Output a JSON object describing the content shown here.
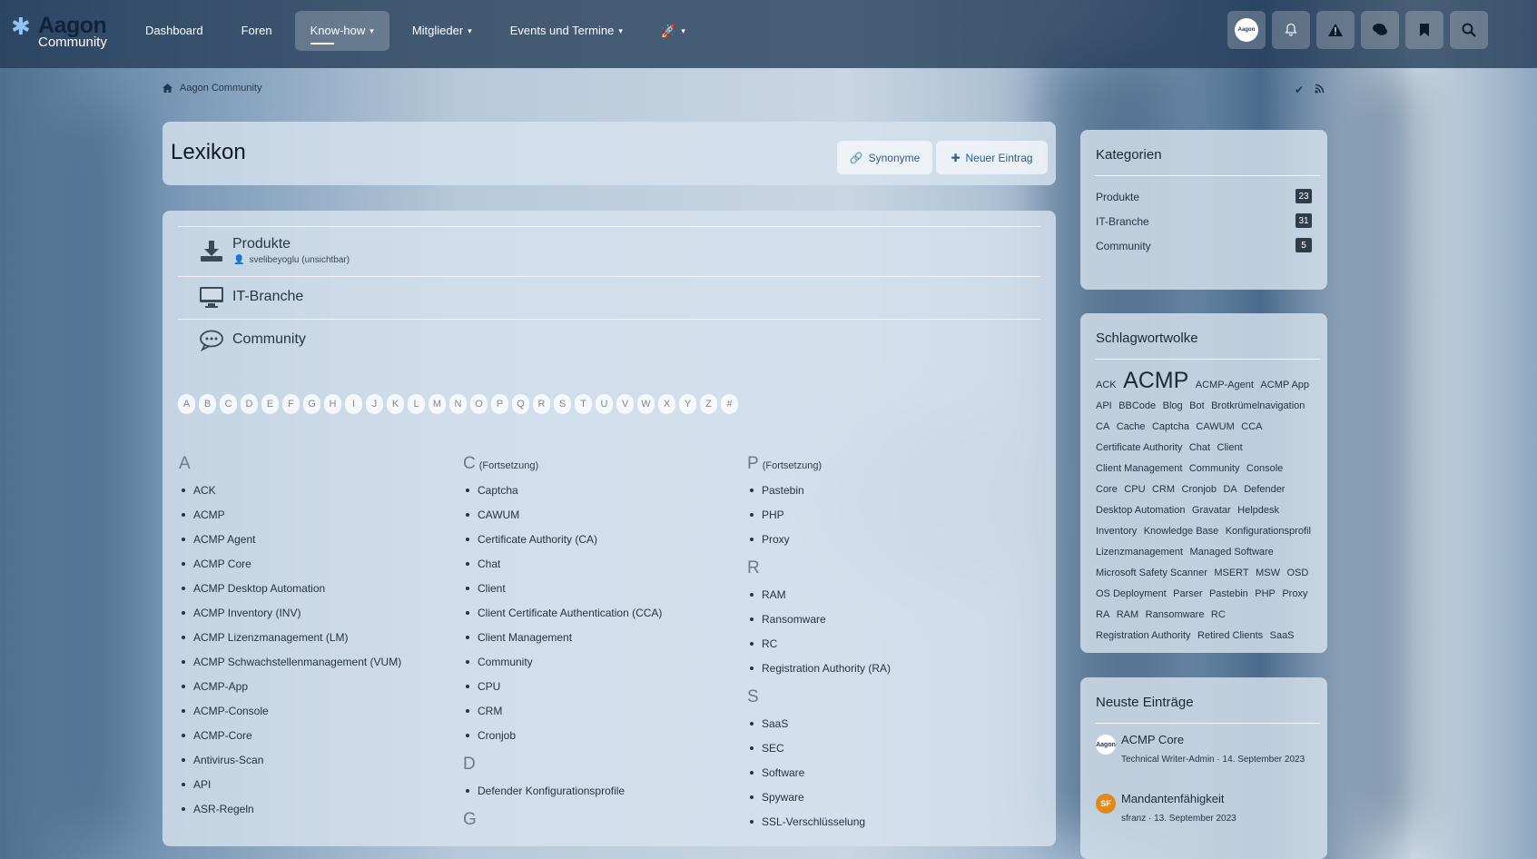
{
  "header": {
    "logo_main": "Aagon",
    "logo_sub": "Community",
    "nav": [
      {
        "label": "Dashboard",
        "active": false,
        "dropdown": false
      },
      {
        "label": "Foren",
        "active": false,
        "dropdown": false
      },
      {
        "label": "Know-how",
        "active": true,
        "dropdown": true
      },
      {
        "label": "Mitglieder",
        "active": false,
        "dropdown": true
      },
      {
        "label": "Events und Termine",
        "active": false,
        "dropdown": true
      }
    ],
    "avatar_text": "Aagon"
  },
  "breadcrumb": {
    "label": "Aagon Community"
  },
  "page": {
    "title": "Lexikon",
    "synonyms_button": "Synonyme",
    "new_entry_button": "Neuer Eintrag"
  },
  "categories": [
    {
      "name": "Produkte",
      "sub": "svelibeyoglu (unsichtbar)",
      "icon": "download-icon"
    },
    {
      "name": "IT-Branche",
      "icon": "monitor-icon"
    },
    {
      "name": "Community",
      "icon": "chat-bubble-icon"
    }
  ],
  "letters": [
    "A",
    "B",
    "C",
    "D",
    "E",
    "F",
    "G",
    "H",
    "I",
    "J",
    "K",
    "L",
    "M",
    "N",
    "O",
    "P",
    "Q",
    "R",
    "S",
    "T",
    "U",
    "V",
    "W",
    "X",
    "Y",
    "Z",
    "#"
  ],
  "columns": {
    "col1": {
      "groups": [
        {
          "letter": "A",
          "items": [
            "ACK",
            "ACMP",
            "ACMP Agent",
            "ACMP Core",
            "ACMP Desktop Automation",
            "ACMP Inventory (INV)",
            "ACMP Lizenzmanagement (LM)",
            "ACMP Schwachstellenmanagement (VUM)",
            "ACMP-App",
            "ACMP-Console",
            "ACMP-Core",
            "Antivirus-Scan",
            "API",
            "ASR-Regeln"
          ]
        }
      ]
    },
    "col2": {
      "cont_label": "(Fortsetzung)",
      "groups": [
        {
          "letter": "C",
          "items": [
            "Captcha",
            "CAWUM",
            "Certificate Authority (CA)",
            "Chat",
            "Client",
            "Client Certificate Authentication (CCA)",
            "Client Management",
            "Community",
            "CPU",
            "CRM",
            "Cronjob"
          ]
        },
        {
          "letter": "D",
          "items": [
            "Defender Konfigurationsprofile"
          ]
        },
        {
          "letter": "G",
          "items": []
        }
      ]
    },
    "col3": {
      "cont_label": "(Fortsetzung)",
      "groups": [
        {
          "letter": "P",
          "items": [
            "Pastebin",
            "PHP",
            "Proxy"
          ]
        },
        {
          "letter": "R",
          "items": [
            "RAM",
            "Ransomware",
            "RC",
            "Registration Authority (RA)"
          ]
        },
        {
          "letter": "S",
          "items": [
            "SaaS",
            "SEC",
            "Software",
            "Spyware",
            "SSL-Verschlüsselung"
          ]
        }
      ]
    }
  },
  "sidebar": {
    "categories_title": "Kategorien",
    "categories": [
      {
        "name": "Produkte",
        "count": "23"
      },
      {
        "name": "IT-Branche",
        "count": "31"
      },
      {
        "name": "Community",
        "count": "5"
      }
    ],
    "tags_title": "Schlagwortwolke",
    "tags": [
      "ACK",
      "ACMP",
      "ACMP-Agent",
      "ACMP App",
      "API",
      "BBCode",
      "Blog",
      "Bot",
      "Brotkrümelnavigation",
      "CA",
      "Cache",
      "Captcha",
      "CAWUM",
      "CCA",
      "Certificate Authority",
      "Chat",
      "Client",
      "Client Management",
      "Community",
      "Console",
      "Core",
      "CPU",
      "CRM",
      "Cronjob",
      "DA",
      "Defender",
      "Desktop Automation",
      "Gravatar",
      "Helpdesk",
      "Inventory",
      "Knowledge Base",
      "Konfigurationsprofil",
      "Lizenzmanagement",
      "Managed Software",
      "Microsoft Safety Scanner",
      "MSERT",
      "MSW",
      "OSD",
      "OS Deployment",
      "Parser",
      "Pastebin",
      "PHP",
      "Proxy",
      "RA",
      "RAM",
      "Ransomware",
      "RC",
      "Registration Authority",
      "Retired Clients",
      "SaaS"
    ],
    "big_tag": "ACMP",
    "latest_title": "Neuste Einträge",
    "latest": [
      {
        "title": "ACMP Core",
        "meta": "Technical Writer-Admin · 14. September 2023",
        "avatar": "Aagon"
      },
      {
        "title": "Mandantenfähigkeit",
        "meta": "sfranz · 13. September 2023",
        "avatar": "SF"
      }
    ]
  },
  "colors": {
    "header_bg": "#223a56",
    "accent_link": "#2a5f95",
    "badge_bg": "#2f3d4b",
    "avatar_sf": "#e08a1e"
  }
}
